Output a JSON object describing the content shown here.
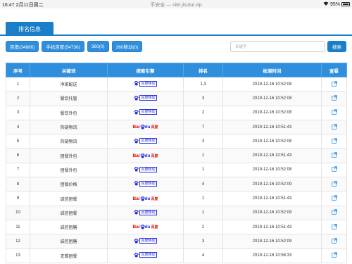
{
  "status_bar": {
    "time": "16:47",
    "date": "2月11日周二",
    "url_text": "不安全 — site.jisutui.vip",
    "battery": "95%"
  },
  "tab": {
    "label": "排名信息"
  },
  "filters": [
    {
      "label": "百度(34886)"
    },
    {
      "label": "手机百度(54736)"
    },
    {
      "label": "360(0)"
    },
    {
      "label": "360移动(0)"
    }
  ],
  "search": {
    "placeholder": "关键字",
    "button_label": "搜索"
  },
  "table": {
    "headers": [
      "序号",
      "关键词",
      "搜索引擎",
      "排名",
      "检测时间",
      "查看"
    ],
    "rows": [
      {
        "index": "1",
        "keyword": "净菜配送",
        "engine": "mobile",
        "rank": "1,3",
        "time": "2019-12-16 10:52:08"
      },
      {
        "index": "2",
        "keyword": "餐饮托管",
        "engine": "mobile",
        "rank": "3",
        "time": "2019-12-16 10:52:08"
      },
      {
        "index": "3",
        "keyword": "餐饮外包",
        "engine": "mobile",
        "rank": "2",
        "time": "2019-12-16 10:52:08"
      },
      {
        "index": "4",
        "keyword": "热链物流",
        "engine": "pc",
        "rank": "7",
        "time": "2019-12-16 10:51:43"
      },
      {
        "index": "5",
        "keyword": "热链物流",
        "engine": "mobile",
        "rank": "3",
        "time": "2019-12-16 10:52:08"
      },
      {
        "index": "6",
        "keyword": "团餐外包",
        "engine": "pc",
        "rank": "1",
        "time": "2019-12-16 10:51:43"
      },
      {
        "index": "7",
        "keyword": "团餐外包",
        "engine": "mobile",
        "rank": "1",
        "time": "2019-12-16 10:52:08"
      },
      {
        "index": "8",
        "keyword": "团餐价格",
        "engine": "mobile",
        "rank": "4",
        "time": "2019-12-16 10:52:09"
      },
      {
        "index": "9",
        "keyword": "诚信团餐",
        "engine": "pc",
        "rank": "1",
        "time": "2019-12-16 10:51:43"
      },
      {
        "index": "10",
        "keyword": "诚信团餐",
        "engine": "mobile",
        "rank": "1",
        "time": "2019-12-16 10:52:09"
      },
      {
        "index": "11",
        "keyword": "诚信团膳",
        "engine": "pc",
        "rank": "2",
        "time": "2019-12-16 10:51:43"
      },
      {
        "index": "12",
        "keyword": "诚信团膳",
        "engine": "mobile",
        "rank": "3",
        "time": "2019-12-16 10:52:09"
      },
      {
        "index": "13",
        "keyword": "无锡团餐",
        "engine": "mobile",
        "rank": "4",
        "time": "2019-12-16 10:58:33"
      }
    ]
  },
  "engine_logos": {
    "mobile_text": "百度移动",
    "pc_bai": "Bai",
    "pc_du": "du",
    "pc_cn": "百度"
  },
  "colors": {
    "accent": "#1b7ec8",
    "header_bg": "#2f8fdd",
    "baidu_blue": "#2932e1",
    "baidu_red": "#e10602"
  }
}
